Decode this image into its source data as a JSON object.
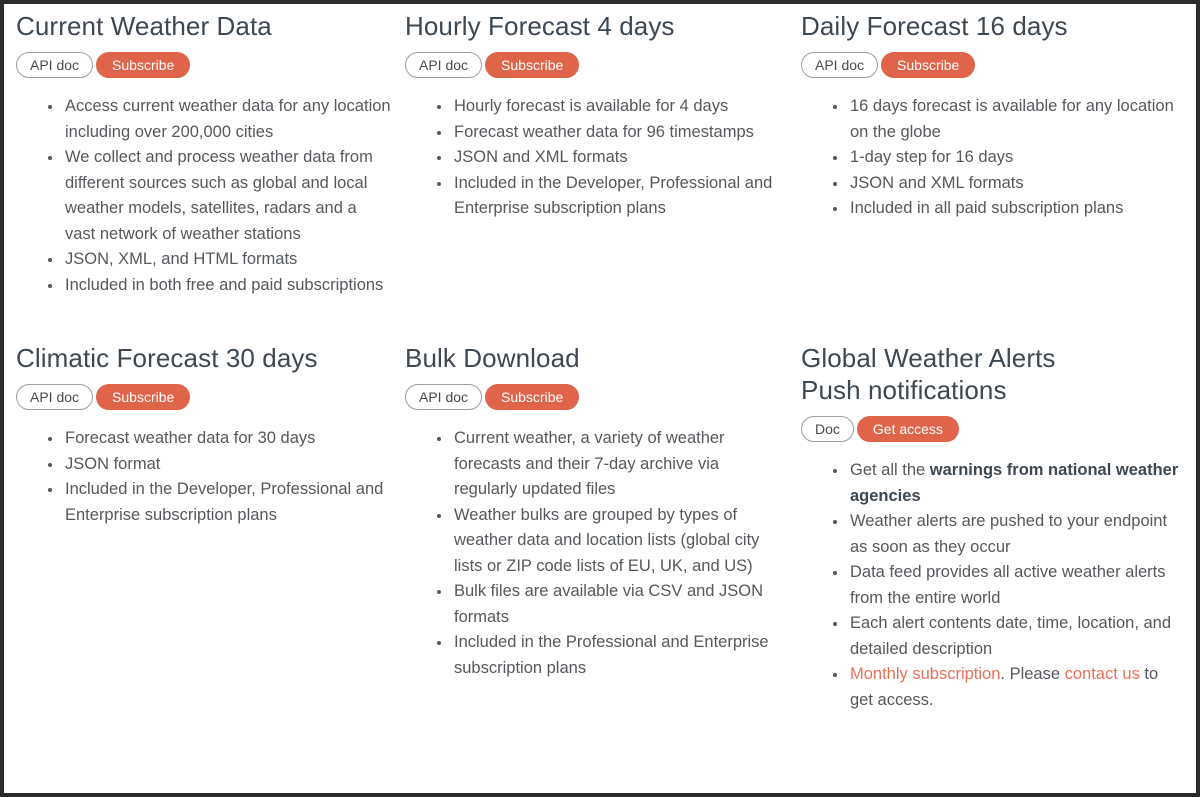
{
  "theme": {
    "accent": "#e0644a",
    "link": "#e8705a",
    "heading_color": "#3d4852",
    "body_color": "#55585c",
    "outline_border": "#9aa0a6",
    "page_border": "#2b2b2b",
    "background": "#ffffff"
  },
  "cards": [
    {
      "id": "current-weather-data",
      "title": "Current Weather Data",
      "buttons": [
        {
          "label": "API doc",
          "style": "outline",
          "name": "api-doc-button"
        },
        {
          "label": "Subscribe",
          "style": "solid",
          "name": "subscribe-button"
        }
      ],
      "features": [
        "Access current weather data for any location including over 200,000 cities",
        "We collect and process weather data from different sources such as global and local weather models, satellites, radars and a vast network of weather stations",
        "JSON, XML, and HTML formats",
        "Included in both free and paid subscriptions"
      ]
    },
    {
      "id": "hourly-forecast-4-days",
      "title": "Hourly Forecast 4 days",
      "buttons": [
        {
          "label": "API doc",
          "style": "outline",
          "name": "api-doc-button"
        },
        {
          "label": "Subscribe",
          "style": "solid",
          "name": "subscribe-button"
        }
      ],
      "features": [
        "Hourly forecast is available for 4 days",
        "Forecast weather data for 96 timestamps",
        "JSON and XML formats",
        "Included in the Developer, Professional and Enterprise subscription plans"
      ]
    },
    {
      "id": "daily-forecast-16-days",
      "title": "Daily Forecast 16 days",
      "buttons": [
        {
          "label": "API doc",
          "style": "outline",
          "name": "api-doc-button"
        },
        {
          "label": "Subscribe",
          "style": "solid",
          "name": "subscribe-button"
        }
      ],
      "features": [
        "16 days forecast is available for any location on the globe",
        "1-day step for 16 days",
        "JSON and XML formats",
        "Included in all paid subscription plans"
      ]
    },
    {
      "id": "climatic-forecast-30-days",
      "title": "Climatic Forecast 30 days",
      "buttons": [
        {
          "label": "API doc",
          "style": "outline",
          "name": "api-doc-button"
        },
        {
          "label": "Subscribe",
          "style": "solid",
          "name": "subscribe-button"
        }
      ],
      "features": [
        "Forecast weather data for 30 days",
        "JSON format",
        "Included in the Developer, Professional and Enterprise subscription plans"
      ]
    },
    {
      "id": "bulk-download",
      "title": "Bulk Download",
      "buttons": [
        {
          "label": "API doc",
          "style": "outline",
          "name": "api-doc-button"
        },
        {
          "label": "Subscribe",
          "style": "solid",
          "name": "subscribe-button"
        }
      ],
      "features": [
        "Current weather, a variety of weather forecasts and their 7-day archive via regularly updated files",
        "Weather bulks are grouped by types of weather data and location lists (global city lists or ZIP code lists of EU, UK, and US)",
        "Bulk files are available via CSV and JSON formats",
        "Included in the Professional and Enterprise subscription plans"
      ]
    },
    {
      "id": "global-weather-alerts",
      "title_line1": "Global Weather Alerts",
      "title_line2": "Push notifications",
      "buttons": [
        {
          "label": "Doc",
          "style": "outline",
          "name": "doc-button"
        },
        {
          "label": "Get access",
          "style": "solid",
          "name": "get-access-button"
        }
      ],
      "features_rich": [
        [
          {
            "text": "Get all the ",
            "style": "plain"
          },
          {
            "text": "warnings from national weather agencies",
            "style": "bold"
          }
        ],
        [
          {
            "text": "Weather alerts are pushed to your endpoint as soon as they occur",
            "style": "plain"
          }
        ],
        [
          {
            "text": "Data feed provides all active weather alerts from the entire world",
            "style": "plain"
          }
        ],
        [
          {
            "text": "Each alert contents date, time, location, and detailed description",
            "style": "plain"
          }
        ],
        [
          {
            "text": "Monthly subscription",
            "style": "link"
          },
          {
            "text": ". Please ",
            "style": "plain"
          },
          {
            "text": "contact us",
            "style": "link"
          },
          {
            "text": " to get access.",
            "style": "plain"
          }
        ]
      ]
    }
  ]
}
